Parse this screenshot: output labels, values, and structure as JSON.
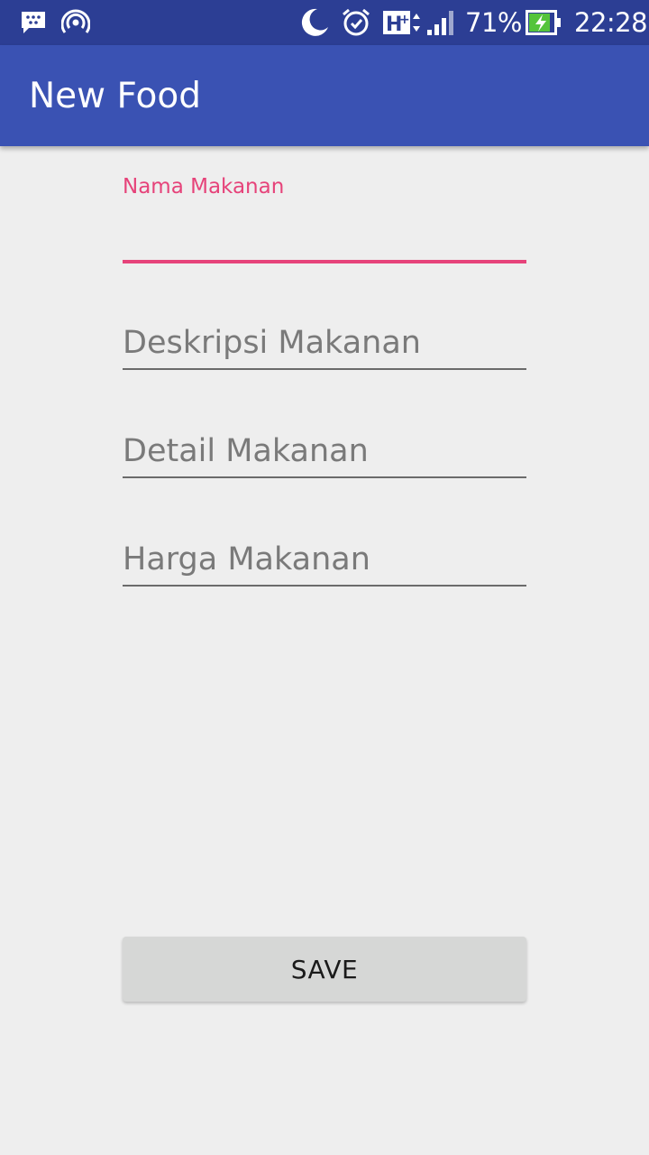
{
  "status_bar": {
    "battery": "71%",
    "time": "22:28",
    "network": "H+",
    "icons": [
      "bbm-chat-icon",
      "hotspot-icon",
      "moon-icon",
      "alarm-icon",
      "network-h-plus-icon",
      "signal-icon",
      "battery-charging-icon"
    ]
  },
  "app_bar": {
    "title": "New Food"
  },
  "form": {
    "name_label": "Nama Makanan",
    "name_value": "",
    "description_placeholder": "Deskripsi Makanan",
    "detail_placeholder": "Detail Makanan",
    "price_placeholder": "Harga Makanan"
  },
  "save_label": "SAVE",
  "colors": {
    "status_bar": "#2c3e94",
    "app_bar": "#3a52b3",
    "accent": "#e6437a",
    "background": "#eeeeee",
    "button": "#d6d7d6"
  }
}
